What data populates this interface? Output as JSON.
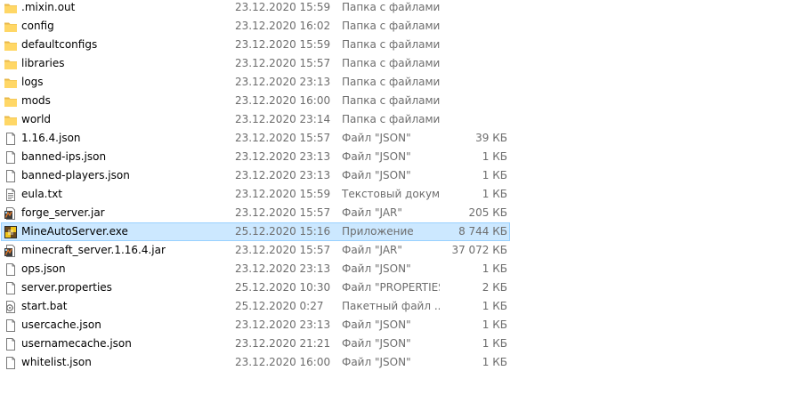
{
  "files": [
    {
      "name": ".mixin.out",
      "date": "23.12.2020 15:59",
      "type": "Папка с файлами",
      "size": "",
      "icon": "folder-icon"
    },
    {
      "name": "config",
      "date": "23.12.2020 16:02",
      "type": "Папка с файлами",
      "size": "",
      "icon": "folder-icon"
    },
    {
      "name": "defaultconfigs",
      "date": "23.12.2020 15:59",
      "type": "Папка с файлами",
      "size": "",
      "icon": "folder-icon"
    },
    {
      "name": "libraries",
      "date": "23.12.2020 15:57",
      "type": "Папка с файлами",
      "size": "",
      "icon": "folder-icon"
    },
    {
      "name": "logs",
      "date": "23.12.2020 23:13",
      "type": "Папка с файлами",
      "size": "",
      "icon": "folder-icon"
    },
    {
      "name": "mods",
      "date": "23.12.2020 16:00",
      "type": "Папка с файлами",
      "size": "",
      "icon": "folder-icon"
    },
    {
      "name": "world",
      "date": "23.12.2020 23:14",
      "type": "Папка с файлами",
      "size": "",
      "icon": "folder-icon"
    },
    {
      "name": "1.16.4.json",
      "date": "23.12.2020 15:57",
      "type": "Файл \"JSON\"",
      "size": "39 КБ",
      "icon": "document-icon"
    },
    {
      "name": "banned-ips.json",
      "date": "23.12.2020 23:13",
      "type": "Файл \"JSON\"",
      "size": "1 КБ",
      "icon": "document-icon"
    },
    {
      "name": "banned-players.json",
      "date": "23.12.2020 23:13",
      "type": "Файл \"JSON\"",
      "size": "1 КБ",
      "icon": "document-icon"
    },
    {
      "name": "eula.txt",
      "date": "23.12.2020 15:59",
      "type": "Текстовый докум...",
      "size": "1 КБ",
      "icon": "text-document-icon"
    },
    {
      "name": "forge_server.jar",
      "date": "23.12.2020 15:57",
      "type": "Файл \"JAR\"",
      "size": "205 КБ",
      "icon": "jar-icon"
    },
    {
      "name": "MineAutoServer.exe",
      "date": "25.12.2020 15:16",
      "type": "Приложение",
      "size": "8 744 КБ",
      "icon": "app-icon",
      "selected": true
    },
    {
      "name": "minecraft_server.1.16.4.jar",
      "date": "23.12.2020 15:57",
      "type": "Файл \"JAR\"",
      "size": "37 072 КБ",
      "icon": "jar-icon"
    },
    {
      "name": "ops.json",
      "date": "23.12.2020 23:13",
      "type": "Файл \"JSON\"",
      "size": "1 КБ",
      "icon": "document-icon"
    },
    {
      "name": "server.properties",
      "date": "25.12.2020 10:30",
      "type": "Файл \"PROPERTIES\"",
      "size": "2 КБ",
      "icon": "document-icon"
    },
    {
      "name": "start.bat",
      "date": "25.12.2020 0:27",
      "type": "Пакетный файл ...",
      "size": "1 КБ",
      "icon": "batch-file-icon"
    },
    {
      "name": "usercache.json",
      "date": "23.12.2020 23:13",
      "type": "Файл \"JSON\"",
      "size": "1 КБ",
      "icon": "document-icon"
    },
    {
      "name": "usernamecache.json",
      "date": "23.12.2020 21:21",
      "type": "Файл \"JSON\"",
      "size": "1 КБ",
      "icon": "document-icon"
    },
    {
      "name": "whitelist.json",
      "date": "23.12.2020 16:00",
      "type": "Файл \"JSON\"",
      "size": "1 КБ",
      "icon": "document-icon"
    }
  ],
  "colors": {
    "selection_fill": "#cce8ff",
    "selection_border": "#99d1ff",
    "folder": "#ffd766",
    "secondary_text": "#6d6d6d"
  }
}
